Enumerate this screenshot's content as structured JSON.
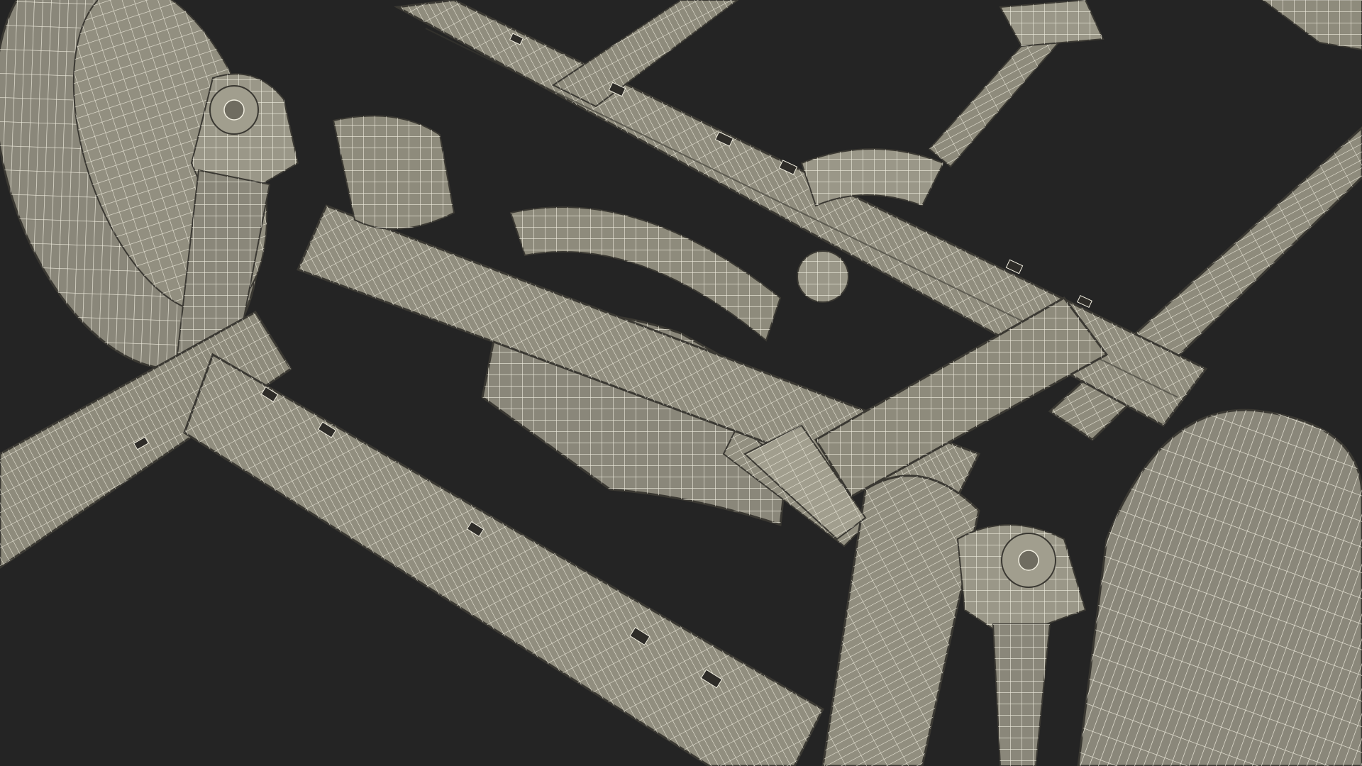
{
  "scene": {
    "background": "#242424",
    "mesh_fill": "#8e8b7c",
    "mesh_fill_light": "#a19e8e",
    "mesh_fill_dark": "#6f6c60",
    "wire_color": "#f1eee0",
    "edge_color": "#3a3832"
  }
}
